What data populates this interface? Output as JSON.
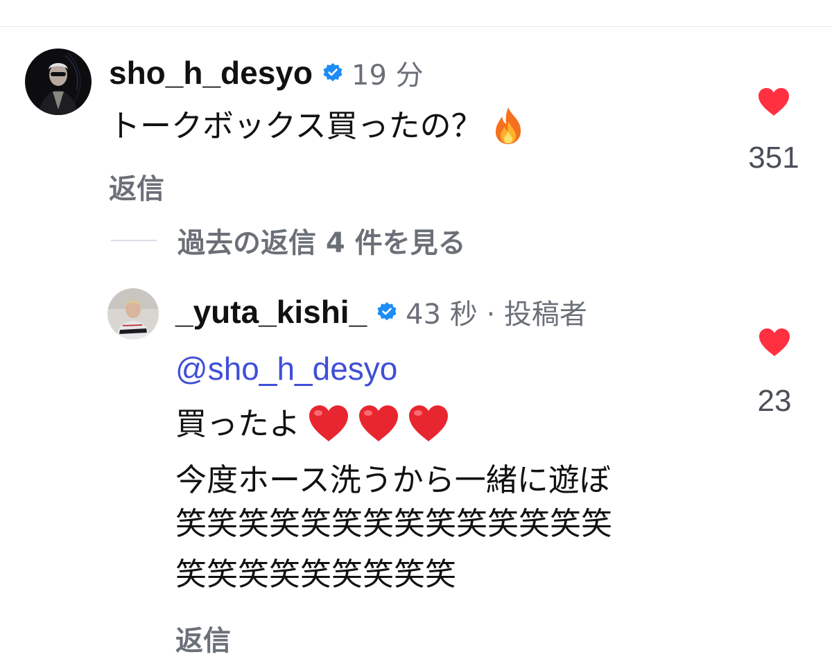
{
  "comments": [
    {
      "username": "sho_h_desyo",
      "verified": true,
      "meta": "19 分",
      "text": "トークボックス買ったの？",
      "emoji": "fire-icon",
      "reply_label": "返信",
      "likes": "351"
    }
  ],
  "view_replies": {
    "label": "過去の返信 4 件を見る"
  },
  "replies": [
    {
      "username": "_yuta_kishi_",
      "verified": true,
      "meta": "43 秒 · 投稿者",
      "mention": "@sho_h_desyo",
      "lines": [
        "買ったよ",
        "今度ホース洗うから一緒に遊ぼ",
        "笑笑笑笑笑笑笑笑笑笑笑笑笑笑",
        "笑笑笑笑笑笑笑笑笑"
      ],
      "emojis": [
        "heart-emoji",
        "heart-emoji",
        "heart-emoji"
      ],
      "reply_label": "返信",
      "likes": "23"
    }
  ],
  "colors": {
    "like_red": "#ff3040",
    "verified_blue": "#1d8cf5",
    "mention_blue": "#3f4fd6",
    "meta_gray": "#6b7078"
  }
}
